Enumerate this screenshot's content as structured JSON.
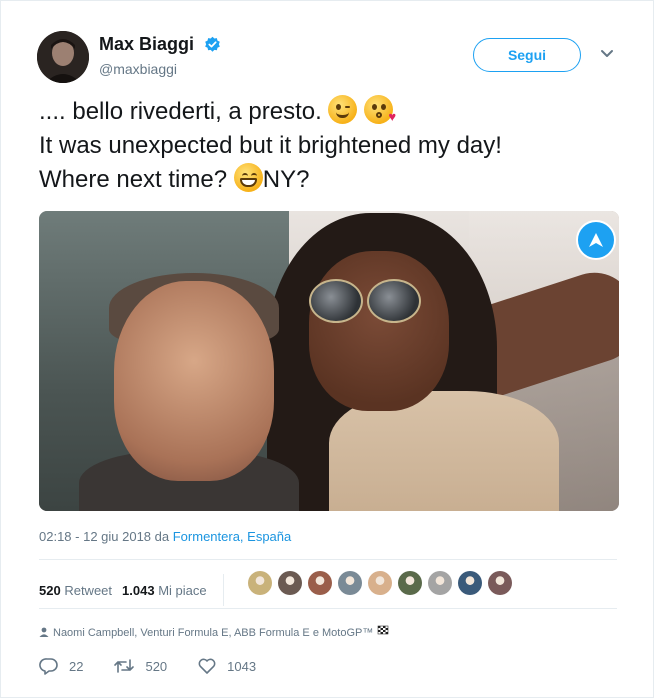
{
  "author": {
    "name": "Max Biaggi",
    "handle": "@maxbiaggi",
    "verified_icon": "verified-badge-icon"
  },
  "header": {
    "follow_label": "Segui",
    "caret_icon": "chevron-down-icon"
  },
  "tweet": {
    "lines": [
      ".... bello rivederti, a presto.",
      "It was unexpected but it brightened my day!",
      "Where next time?",
      "NY?"
    ],
    "emojis": [
      "winking-face",
      "kissing-heart-face",
      "grinning-face"
    ]
  },
  "photo": {
    "description_icon": "selfie-photo",
    "overlay_icon": "navigation-arrow-icon"
  },
  "meta": {
    "time": "02:18 - 12 giu 2018 da",
    "location": "Formentera, España"
  },
  "stats": {
    "retweets_count": "520",
    "retweets_label": "Retweet",
    "likes_count": "1.043",
    "likes_label": "Mi piace",
    "likers": [
      "#c9b27a",
      "#6b5a52",
      "#9a5e4a",
      "#7a8a96",
      "#d8b08c",
      "#5a6a4a",
      "#a4a4a4",
      "#3a5a7a",
      "#7a5a5a"
    ]
  },
  "context": {
    "text": "Naomi Campbell, Venturi Formula E, ABB Formula E e MotoGP™"
  },
  "actions": {
    "reply_count": "22",
    "retweet_count": "520",
    "like_count": "1043"
  },
  "colors": {
    "accent": "#1da1f2",
    "link": "#1b95e0",
    "muted": "#657786",
    "text": "#14171a"
  }
}
